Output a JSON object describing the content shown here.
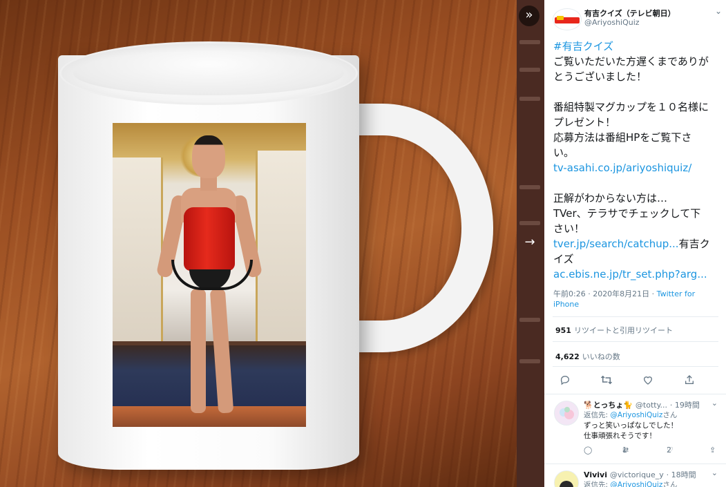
{
  "viewer": {
    "expand_icon": "chevrons-right-icon",
    "next_icon": "arrow-right-icon"
  },
  "tweet": {
    "display_name": "有吉クイズ（テレビ朝日）",
    "handle": "@AriyoshiQuiz",
    "text_lines": [
      "#有吉クイズ",
      "ご覧いただいた方遅くまでありが",
      "とうございました！",
      "",
      "番組特製マグカップを１０名様に",
      "プレゼント！",
      "応募方法は番組HPをご覧下さ",
      "い。",
      "tv-asahi.co.jp/ariyoshiquiz/",
      "",
      "正解がわからない方は…",
      "TVer、テラサでチェックして下",
      "さい！"
    ],
    "link_line_a": "tver.jp/search/catchup...",
    "link_line_a_tail": "有吉ク",
    "link_line_b": "イズ",
    "link_line_c": "ac.ebis.ne.jp/tr_set.php?arg...",
    "timestamp": "午前0:26 · 2020年8月21日 · ",
    "source_a": "Twitter for",
    "source_b": "iPhone",
    "retweets_count": "951",
    "retweets_label": "リツイートと引用リツイート",
    "likes_count": "4,622",
    "likes_label": "いいねの数"
  },
  "actions": {
    "reply_icon": "reply-icon",
    "retweet_icon": "retweet-icon",
    "like_icon": "heart-icon",
    "share_icon": "share-icon"
  },
  "replies": [
    {
      "name": "🐕とっちょ🐈",
      "handle": "@totty...",
      "time": "· 19時間",
      "reply_to_prefix": "返信先: ",
      "reply_to_mention": "@AriyoshiQuiz",
      "reply_to_suffix": "さん",
      "text_lines": [
        "ずっと笑いっぱなしでした！",
        "仕事頑張れそうです！"
      ],
      "retweets": "1",
      "likes": "2"
    },
    {
      "name": "Vivivi",
      "handle": "@victorique_y",
      "time": "· 18時間",
      "reply_to_prefix": "返信先: ",
      "reply_to_mention": "@AriyoshiQuiz",
      "reply_to_suffix": "さん"
    }
  ],
  "colors": {
    "link": "#1b95e0",
    "text": "#14171a",
    "muted": "#657786",
    "corset": "#e52a1c"
  }
}
